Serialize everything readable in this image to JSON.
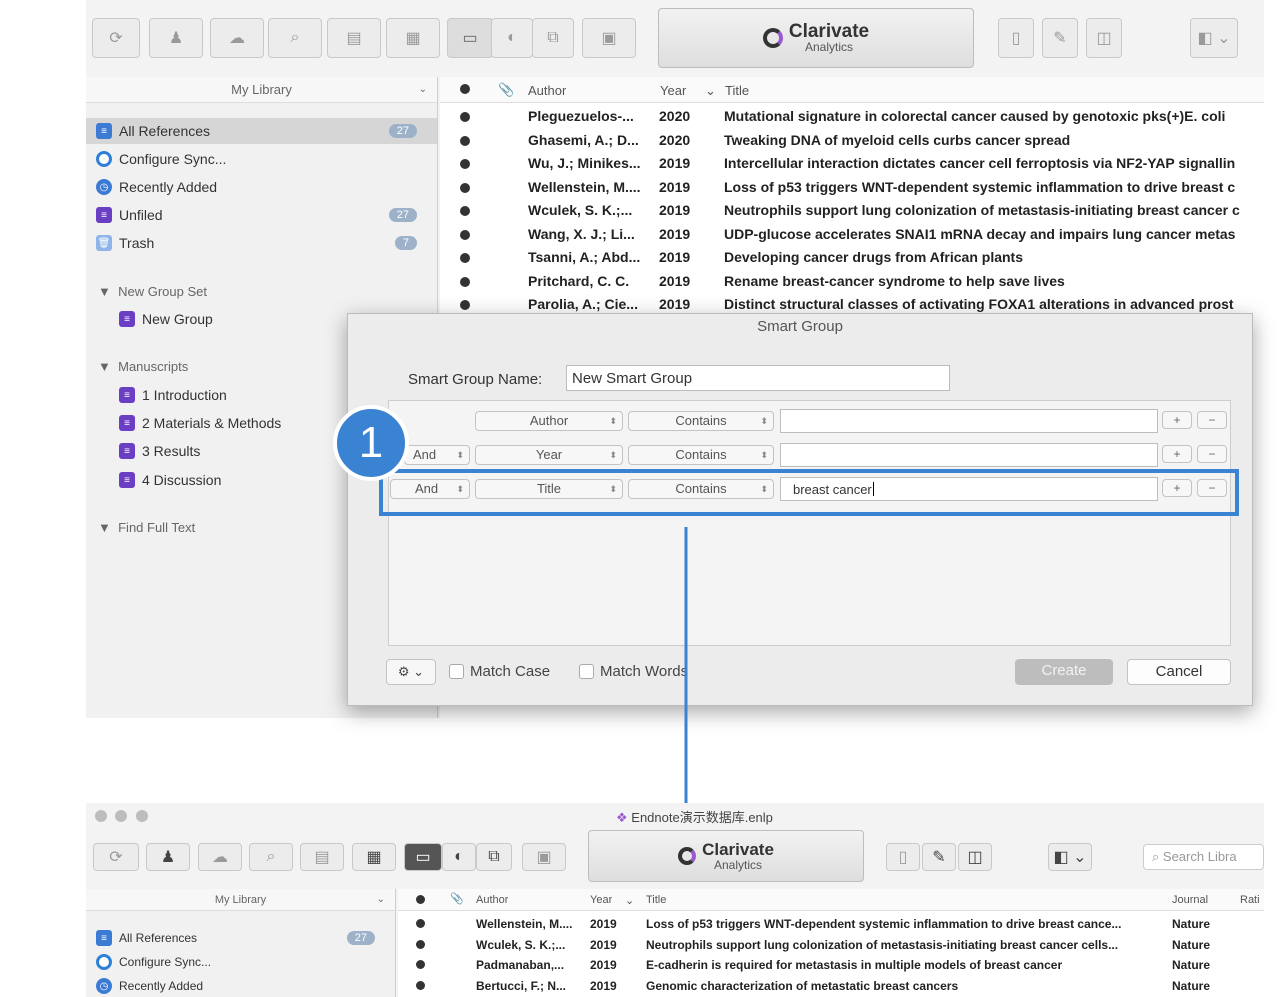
{
  "top": {
    "brand": {
      "title": "Clarivate",
      "subtitle": "Analytics"
    },
    "sidebar": {
      "header": "My Library",
      "items": [
        {
          "label": "All References",
          "badge": "27",
          "selected": true
        },
        {
          "label": "Configure Sync..."
        },
        {
          "label": "Recently Added"
        },
        {
          "label": "Unfiled",
          "badge": "27"
        },
        {
          "label": "Trash",
          "badge": "7"
        }
      ],
      "group_set": "New Group Set",
      "group": "New Group",
      "manuscripts": "Manuscripts",
      "manuscript_items": [
        "1 Introduction",
        "2 Materials & Methods",
        "3 Results",
        "4 Discussion"
      ],
      "find_full_text": "Find Full Text"
    },
    "list": {
      "headers": {
        "author": "Author",
        "year": "Year",
        "title": "Title"
      },
      "rows": [
        {
          "author": "Pleguezuelos-...",
          "year": "2020",
          "title": "Mutational signature in colorectal cancer caused by genotoxic pks(+)E. coli"
        },
        {
          "author": "Ghasemi, A.; D...",
          "year": "2020",
          "title": "Tweaking DNA of myeloid cells curbs cancer spread"
        },
        {
          "author": "Wu, J.; Minikes...",
          "year": "2019",
          "title": "Intercellular interaction dictates cancer cell ferroptosis via NF2-YAP signallin"
        },
        {
          "author": "Wellenstein, M....",
          "year": "2019",
          "title": "Loss of p53 triggers WNT-dependent systemic inflammation to drive breast c"
        },
        {
          "author": "Wculek, S. K.;...",
          "year": "2019",
          "title": "Neutrophils support lung colonization of metastasis-initiating breast cancer c"
        },
        {
          "author": "Wang, X. J.; Li...",
          "year": "2019",
          "title": "UDP-glucose accelerates SNAI1 mRNA decay and impairs lung cancer metas"
        },
        {
          "author": "Tsanni, A.; Abd...",
          "year": "2019",
          "title": "Developing cancer drugs from African plants"
        },
        {
          "author": "Pritchard, C. C.",
          "year": "2019",
          "title": "Rename breast-cancer syndrome to help save lives"
        },
        {
          "author": "Parolia, A.; Cie...",
          "year": "2019",
          "title": "Distinct structural classes of activating FOXA1 alterations in advanced prost"
        }
      ]
    }
  },
  "dialog": {
    "title": "Smart Group",
    "name_label": "Smart Group Name:",
    "name_value": "New Smart Group",
    "rows": [
      {
        "bool": "",
        "field": "Author",
        "op": "Contains",
        "value": ""
      },
      {
        "bool": "And",
        "field": "Year",
        "op": "Contains",
        "value": ""
      },
      {
        "bool": "And",
        "field": "Title",
        "op": "Contains",
        "value": "breast cancer"
      }
    ],
    "plus": "+",
    "minus": "−",
    "gear": "⚙ ⌄",
    "match_case": "Match Case",
    "match_words": "Match Words",
    "create": "Create",
    "cancel": "Cancel"
  },
  "annotation": {
    "step": "1",
    "accent": "#3a82d2"
  },
  "bottom": {
    "window_title": "Endnote演示数据库.enlp",
    "brand": {
      "title": "Clarivate",
      "subtitle": "Analytics"
    },
    "search_placeholder": "Search Libra",
    "sidebar": {
      "header": "My Library",
      "items": [
        {
          "label": "All References",
          "badge": "27"
        },
        {
          "label": "Configure Sync..."
        },
        {
          "label": "Recently Added"
        }
      ]
    },
    "list": {
      "headers": {
        "author": "Author",
        "year": "Year",
        "title": "Title",
        "journal": "Journal",
        "rating": "Rati"
      },
      "rows": [
        {
          "author": "Wellenstein, M....",
          "year": "2019",
          "title": "Loss of p53 triggers WNT-dependent systemic inflammation to drive breast cance...",
          "journal": "Nature"
        },
        {
          "author": "Wculek, S. K.;...",
          "year": "2019",
          "title": "Neutrophils support lung colonization of metastasis-initiating breast cancer cells...",
          "journal": "Nature"
        },
        {
          "author": "Padmanaban,...",
          "year": "2019",
          "title": "E-cadherin is required for metastasis in multiple models of breast cancer",
          "journal": "Nature"
        },
        {
          "author": "Bertucci, F.; N...",
          "year": "2019",
          "title": "Genomic characterization of metastatic breast cancers",
          "journal": "Nature"
        }
      ]
    }
  }
}
